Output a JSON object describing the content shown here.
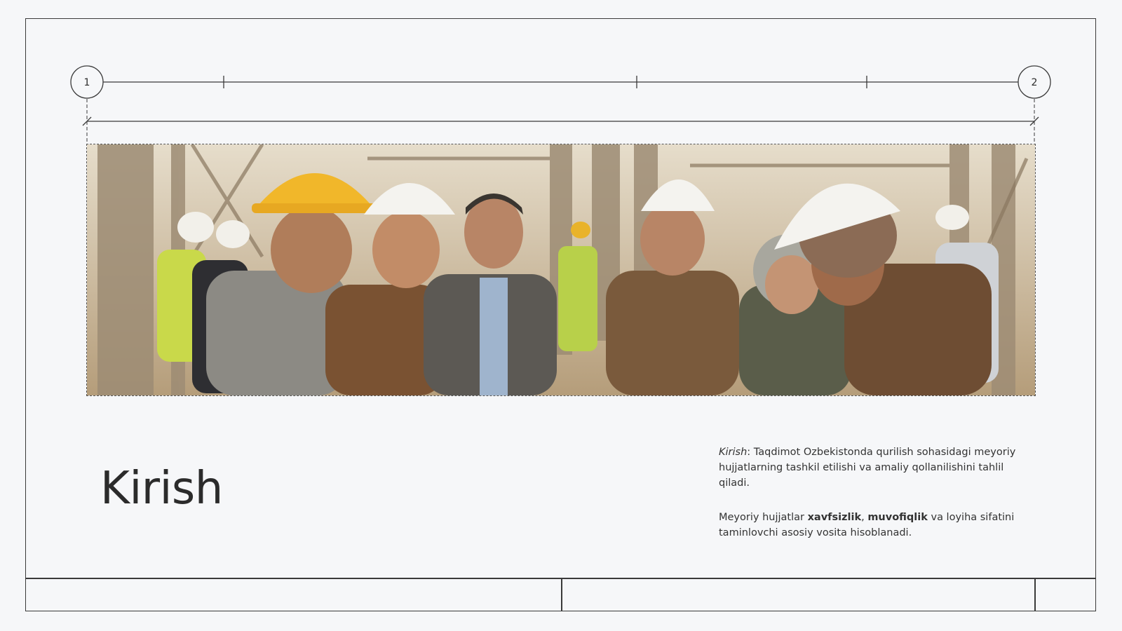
{
  "slide": {
    "grid_markers": {
      "left": "1",
      "right": "2"
    },
    "photo_description_icon": "construction-workers-photo",
    "title": "Kirish",
    "paragraph1": {
      "em": "Kirish",
      "text": ": Taqdimot Ozbekistonda qurilish sohasidagi meyoriy hujjatlarning tashkil etilishi va amaliy qollanilishini tahlil qiladi."
    },
    "paragraph2": {
      "pre": "Meyoriy hujjatlar ",
      "bold1": "xavfsizlik",
      "sep": ", ",
      "bold2": "muvofiqlik",
      "post": " va loyiha sifatini taminlovchi asosiy vosita hisoblanadi."
    }
  },
  "colors": {
    "line": "#3a3a3a",
    "background": "#f6f7f9",
    "text": "#2b2b2b"
  }
}
